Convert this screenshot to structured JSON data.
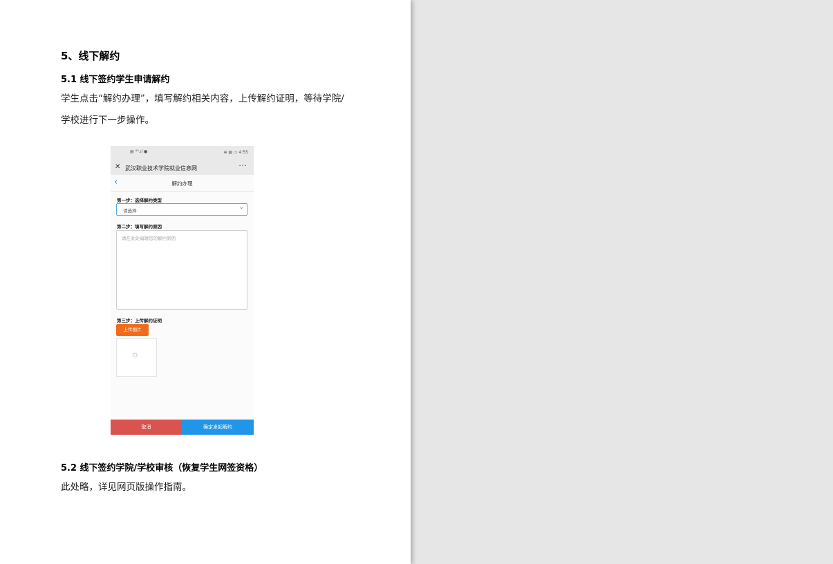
{
  "doc": {
    "heading_5": "5、线下解约",
    "heading_5_1": "5.1  线下签约学生申请解约",
    "para_1": "学生点击“解约办理”，填写解约相关内容，上传解约证明，等待学院/学校进行下一步操作。",
    "heading_5_2": "5.2  线下签约学院/学校审核（恢复学生网签资格）",
    "para_2": "此处略，详见网页版操作指南。"
  },
  "phone": {
    "status_left": "▤ ⁴ᴳ.ıl ●",
    "status_time": "⊕ ▤ ▭ 4:55",
    "app_title": "武汉职业技术学院就业信息网",
    "more": "···",
    "close": "✕",
    "back": "‹",
    "page_title": "解约办理",
    "step1": "第一步：选择解约类型",
    "select_placeholder": "请选择",
    "step2": "第二步：填写解约原因",
    "textarea_placeholder": "请在此处编辑您的解约原因",
    "step3": "第三步：上传解约证明",
    "upload_label": "上传图片",
    "camera": "⊙",
    "cancel_label": "取消",
    "confirm_label": "确定发起解约"
  },
  "colors": {
    "upload_button": "#f06b1c",
    "cancel_button": "#d9534f",
    "confirm_button": "#2196e8",
    "accent": "#2b8ee0"
  }
}
